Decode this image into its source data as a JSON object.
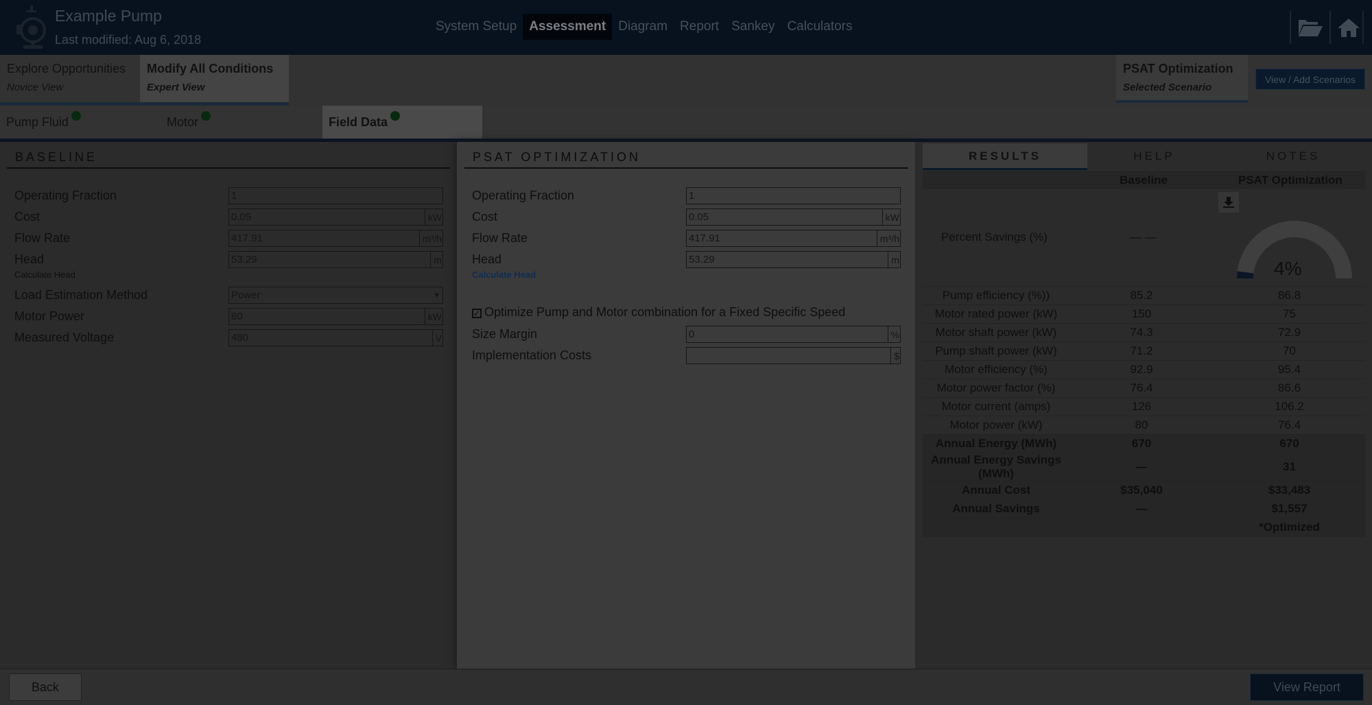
{
  "header": {
    "title": "Example Pump",
    "subtitle": "Last modified: Aug 6, 2018",
    "nav": [
      "System Setup",
      "Assessment",
      "Diagram",
      "Report",
      "Sankey",
      "Calculators"
    ],
    "active_nav": "Assessment",
    "icons": [
      "folder-open-icon",
      "home-icon"
    ]
  },
  "subheader": {
    "explore": {
      "title": "Explore Opportunities",
      "sub": "Novice View"
    },
    "modify": {
      "title": "Modify All Conditions",
      "sub": "Expert View"
    },
    "scenario": {
      "title": "PSAT Optimization",
      "sub": "Selected Scenario"
    },
    "scenario_button": "View / Add Scenarios"
  },
  "tabs": [
    "Pump Fluid",
    "Motor",
    "Field Data"
  ],
  "active_tab": "Field Data",
  "baseline": {
    "title": "BASELINE",
    "operating_fraction": {
      "label": "Operating Fraction",
      "value": "1"
    },
    "cost": {
      "label": "Cost",
      "value": "0.05",
      "unit": "kW"
    },
    "flow_rate": {
      "label": "Flow Rate",
      "value": "417.91",
      "unit": "m³/h"
    },
    "head": {
      "label": "Head",
      "value": "53.29",
      "unit": "m"
    },
    "calc_head": "Calculate Head",
    "load_method": {
      "label": "Load Estimation Method",
      "value": "Power"
    },
    "motor_power": {
      "label": "Motor Power",
      "value": "80",
      "unit": "kW"
    },
    "voltage": {
      "label": "Measured Voltage",
      "value": "480",
      "unit": "V"
    }
  },
  "optimization": {
    "title": "PSAT OPTIMIZATION",
    "operating_fraction": {
      "label": "Operating Fraction",
      "value": "1"
    },
    "cost": {
      "label": "Cost",
      "value": "0.05",
      "unit": "kW"
    },
    "flow_rate": {
      "label": "Flow Rate",
      "value": "417.91",
      "unit": "m³/h"
    },
    "head": {
      "label": "Head",
      "value": "53.29",
      "unit": "m"
    },
    "calc_head": "Calculate Head",
    "optimize_label": "Optimize Pump and Motor combination for a Fixed Specific Speed",
    "size_margin": {
      "label": "Size Margin",
      "value": "0",
      "unit": "%"
    },
    "impl_costs": {
      "label": "Implementation Costs",
      "value": "",
      "unit": "$"
    }
  },
  "results": {
    "tabs": [
      "RESULTS",
      "HELP",
      "NOTES"
    ],
    "col_baseline": "Baseline",
    "col_opt": "PSAT Optimization",
    "percent_label": "Percent Savings (%)",
    "percent_baseline": "— —",
    "percent_value": "4%",
    "percent_fraction": 0.04,
    "rows": [
      {
        "label": "Pump efficiency (%))",
        "baseline": "85.2",
        "opt": "86.8",
        "bold": false
      },
      {
        "label": "Motor rated power (kW)",
        "baseline": "150",
        "opt": "75",
        "bold": false
      },
      {
        "label": "Motor shaft power (kW)",
        "baseline": "74.3",
        "opt": "72.9",
        "bold": false
      },
      {
        "label": "Pump shaft power (kW)",
        "baseline": "71.2",
        "opt": "70",
        "bold": false
      },
      {
        "label": "Motor efficiency (%)",
        "baseline": "92.9",
        "opt": "95.4",
        "bold": false
      },
      {
        "label": "Motor power factor (%)",
        "baseline": "76.4",
        "opt": "86.6",
        "bold": false
      },
      {
        "label": "Motor current (amps)",
        "baseline": "126",
        "opt": "106.2",
        "bold": false
      },
      {
        "label": "Motor power (kW)",
        "baseline": "80",
        "opt": "76.4",
        "bold": false
      },
      {
        "label": "Annual Energy (MWh)",
        "baseline": "670",
        "opt": "670",
        "bold": true
      },
      {
        "label": "Annual Energy Savings (MWh)",
        "baseline": "—",
        "opt": "31",
        "bold": true
      },
      {
        "label": "Annual Cost",
        "baseline": "$35,040",
        "opt": "$33,483",
        "bold": true
      },
      {
        "label": "Annual Savings",
        "baseline": "—",
        "opt": "$1,557",
        "bold": true
      },
      {
        "label": "",
        "baseline": "",
        "opt": "*Optimized",
        "bold": true
      }
    ]
  },
  "footer": {
    "back": "Back",
    "view_report": "View Report"
  }
}
